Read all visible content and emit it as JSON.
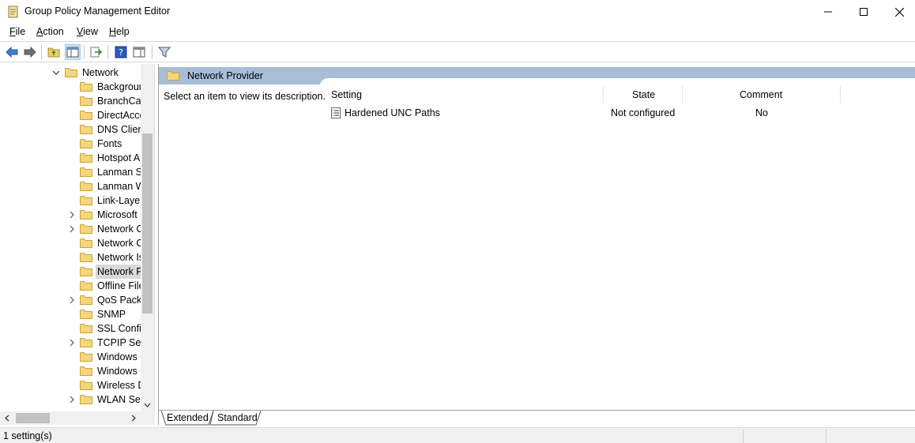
{
  "window": {
    "title": "Group Policy Management Editor"
  },
  "menu": {
    "file": "File",
    "action": "Action",
    "view": "View",
    "help": "Help"
  },
  "tree": {
    "parent": "Network",
    "items": [
      {
        "label": "Backgrour",
        "expandable": false
      },
      {
        "label": "BranchCac",
        "expandable": false
      },
      {
        "label": "DirectAcce",
        "expandable": false
      },
      {
        "label": "DNS Clien",
        "expandable": false
      },
      {
        "label": "Fonts",
        "expandable": false
      },
      {
        "label": "Hotspot A",
        "expandable": false
      },
      {
        "label": "Lanman Se",
        "expandable": false
      },
      {
        "label": "Lanman W",
        "expandable": false
      },
      {
        "label": "Link-Layer",
        "expandable": false
      },
      {
        "label": "Microsoft",
        "expandable": true
      },
      {
        "label": "Network C",
        "expandable": true
      },
      {
        "label": "Network C",
        "expandable": false
      },
      {
        "label": "Network Is",
        "expandable": false
      },
      {
        "label": "Network P",
        "expandable": false,
        "selected": true
      },
      {
        "label": "Offline File",
        "expandable": false
      },
      {
        "label": "QoS Packe",
        "expandable": true
      },
      {
        "label": "SNMP",
        "expandable": false
      },
      {
        "label": "SSL Config",
        "expandable": false
      },
      {
        "label": "TCPIP Sett",
        "expandable": true
      },
      {
        "label": "Windows C",
        "expandable": false
      },
      {
        "label": "Windows C",
        "expandable": false
      },
      {
        "label": "Wireless D",
        "expandable": false
      },
      {
        "label": "WLAN Ser",
        "expandable": true
      }
    ]
  },
  "details": {
    "folder_title": "Network Provider",
    "description": "Select an item to view its description.",
    "columns": {
      "setting": "Setting",
      "state": "State",
      "comment": "Comment"
    },
    "rows": [
      {
        "setting": "Hardened UNC Paths",
        "state": "Not configured",
        "comment": "No"
      }
    ]
  },
  "tabs": {
    "extended": "Extended",
    "standard": "Standard"
  },
  "status": {
    "text": "1 setting(s)"
  }
}
